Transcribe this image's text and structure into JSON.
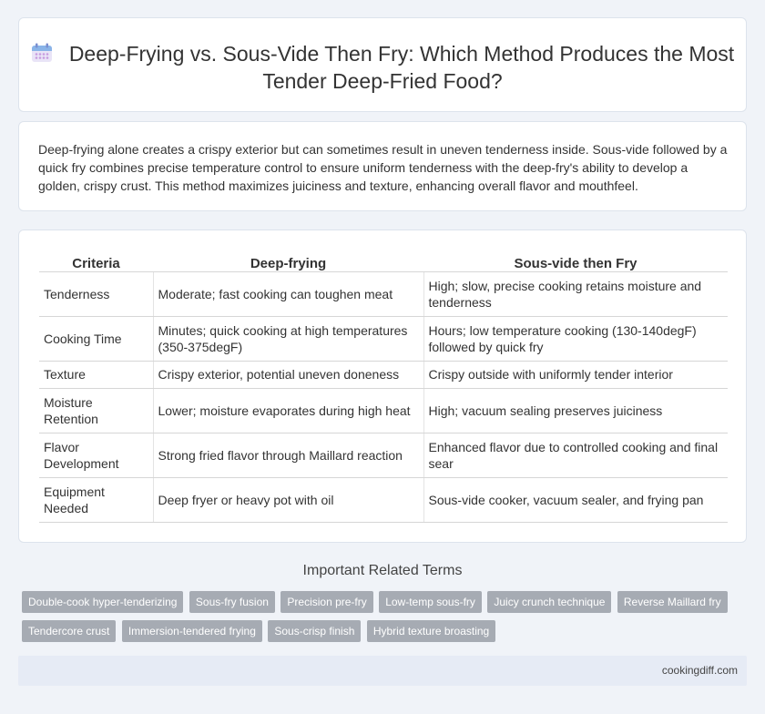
{
  "header": {
    "title": "Deep-Frying vs. Sous-Vide Then Fry: Which Method Produces the Most Tender Deep-Fried Food?"
  },
  "intro": {
    "text": "Deep-frying alone creates a crispy exterior but can sometimes result in uneven tenderness inside. Sous-vide followed by a quick fry combines precise temperature control to ensure uniform tenderness with the deep-fry's ability to develop a golden, crispy crust. This method maximizes juiciness and texture, enhancing overall flavor and mouthfeel."
  },
  "table": {
    "headers": [
      "Criteria",
      "Deep-frying",
      "Sous-vide then Fry"
    ],
    "rows": [
      [
        "Tenderness",
        "Moderate; fast cooking can toughen meat",
        "High; slow, precise cooking retains moisture and tenderness"
      ],
      [
        "Cooking Time",
        "Minutes; quick cooking at high temperatures (350-375degF)",
        "Hours; low temperature cooking (130-140degF) followed by quick fry"
      ],
      [
        "Texture",
        "Crispy exterior, potential uneven doneness",
        "Crispy outside with uniformly tender interior"
      ],
      [
        "Moisture Retention",
        "Lower; moisture evaporates during high heat",
        "High; vacuum sealing preserves juiciness"
      ],
      [
        "Flavor Development",
        "Strong fried flavor through Maillard reaction",
        "Enhanced flavor due to controlled cooking and final sear"
      ],
      [
        "Equipment Needed",
        "Deep fryer or heavy pot with oil",
        "Sous-vide cooker, vacuum sealer, and frying pan"
      ]
    ]
  },
  "terms": {
    "title": "Important Related Terms",
    "items": [
      "Double-cook hyper-tenderizing",
      "Sous-fry fusion",
      "Precision pre-fry",
      "Low-temp sous-fry",
      "Juicy crunch technique",
      "Reverse Maillard fry",
      "Tendercore crust",
      "Immersion-tendered frying",
      "Sous-crisp finish",
      "Hybrid texture broasting"
    ]
  },
  "footer": {
    "site": "cookingdiff.com"
  }
}
